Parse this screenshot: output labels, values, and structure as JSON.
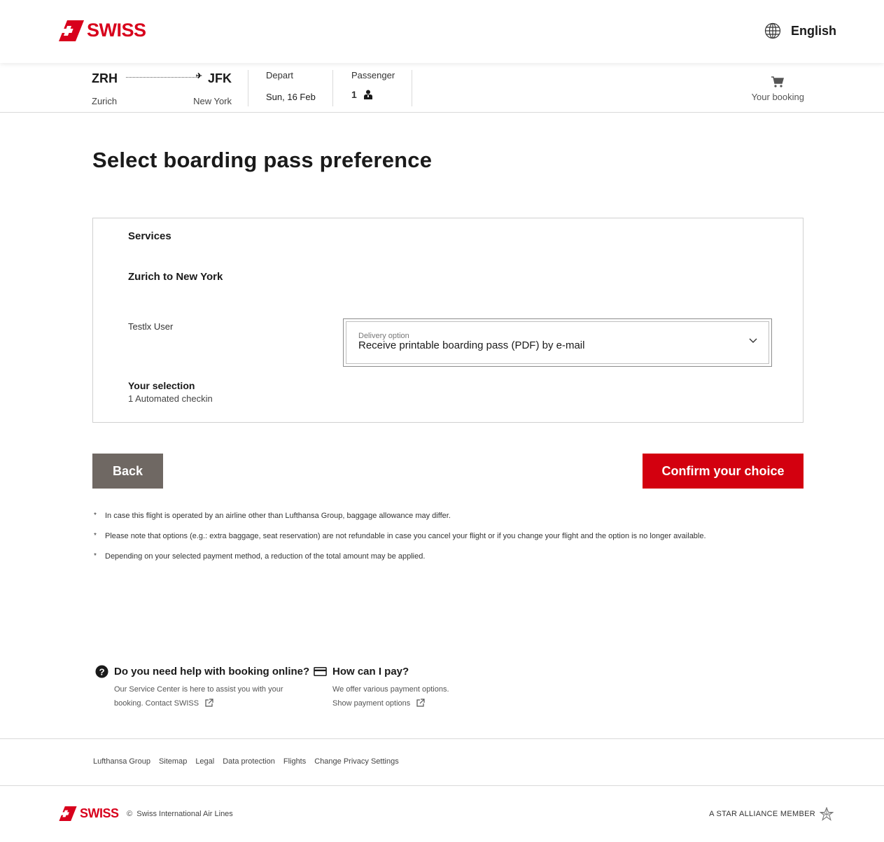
{
  "header": {
    "brand": "SWISS",
    "language": "English"
  },
  "flight": {
    "origin_code": "ZRH",
    "destination_code": "JFK",
    "origin_city": "Zurich",
    "destination_city": "New York",
    "depart_label": "Depart",
    "depart_date": "Sun, 16 Feb",
    "passenger_label": "Passenger",
    "passenger_count": "1",
    "booking_label": "Your booking"
  },
  "main": {
    "title": "Select boarding pass preference",
    "services_label": "Services",
    "segment": "Zurich to New York",
    "passenger_name": "Testlx User",
    "delivery_label": "Delivery option",
    "delivery_value": "Receive printable boarding pass (PDF) by e-mail",
    "selection_title": "Your selection",
    "selection_detail": "1 Automated checkin"
  },
  "buttons": {
    "back": "Back",
    "confirm": "Confirm your choice"
  },
  "notes": [
    "In case this flight is operated by an airline other than Lufthansa Group, baggage allowance may differ.",
    "Please note that options (e.g.: extra baggage, seat reservation) are not refundable in case you cancel your flight or if you change your flight and the option is no longer available.",
    "Depending on your selected payment method, a reduction of the total amount may be applied."
  ],
  "help": {
    "booking_title": "Do you need help with booking online?",
    "booking_body_1": "Our Service Center is here to assist you with your",
    "booking_body_2": "booking.",
    "booking_link": "Contact SWISS",
    "pay_title": "How can I pay?",
    "pay_body": "We offer various payment options.",
    "pay_link": "Show payment options"
  },
  "footer": {
    "links": [
      "Lufthansa Group",
      "Sitemap",
      "Legal",
      "Data protection",
      "Flights",
      "Change Privacy Settings"
    ],
    "brand": "SWISS",
    "copyright_symbol": "©",
    "copyright": "Swiss International Air Lines",
    "alliance": "A STAR ALLIANCE MEMBER"
  },
  "colors": {
    "brand_red": "#d8001c",
    "confirm_red": "#d3000f",
    "back_gray": "#6f6863"
  }
}
